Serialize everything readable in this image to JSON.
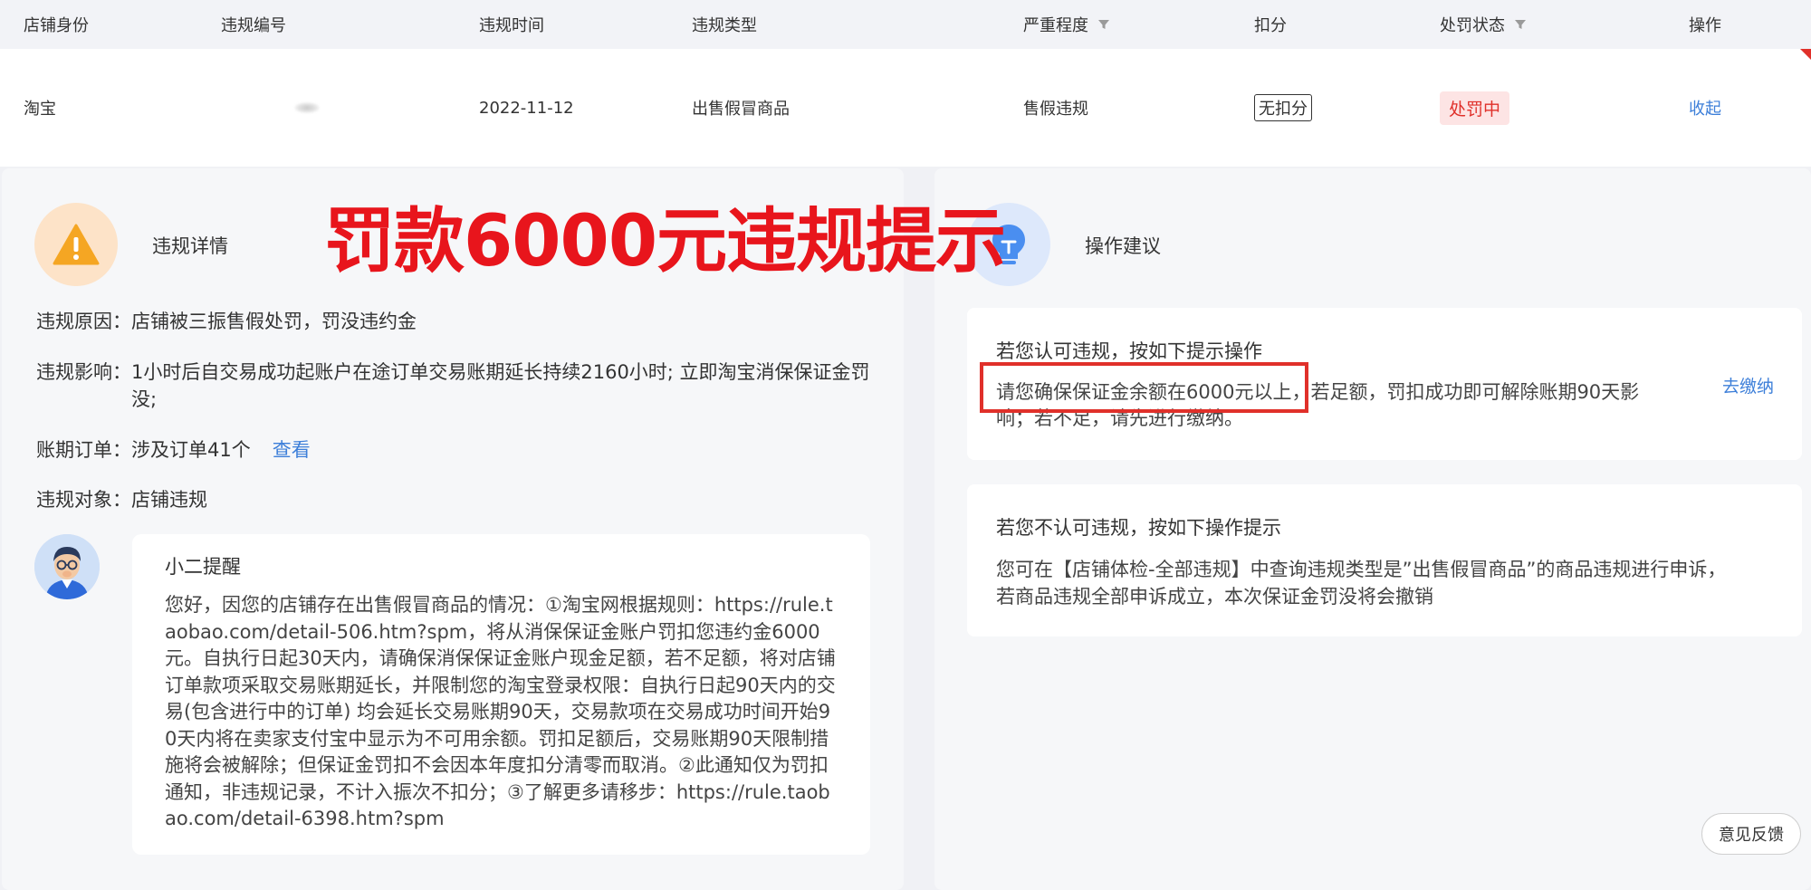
{
  "table": {
    "headers": {
      "store_identity": "店铺身份",
      "violation_no": "违规编号",
      "violation_time": "违规时间",
      "violation_type": "违规类型",
      "severity": "严重程度",
      "deduction": "扣分",
      "penalty_status": "处罚状态",
      "action": "操作"
    },
    "row": {
      "store_identity": "淘宝",
      "violation_no": "",
      "violation_time": "2022-11-12",
      "violation_type": "出售假冒商品",
      "severity": "售假违规",
      "deduction": "无扣分",
      "penalty_status": "处罚中",
      "action": "收起"
    }
  },
  "overlay": {
    "title": "罚款6000元违规提示"
  },
  "details": {
    "title": "违规详情",
    "reason_label": "违规原因：",
    "reason_value": "店铺被三振售假处罚，罚没违约金",
    "impact_label": "违规影响：",
    "impact_value": "1小时后自交易成功起账户在途订单交易账期延长持续2160小时; 立即淘宝消保保证金罚没;",
    "orders_label": "账期订单：",
    "orders_value": "涉及订单41个",
    "orders_link": "查看",
    "target_label": "违规对象：",
    "target_value": "店铺违规",
    "reminder_title": "小二提醒",
    "reminder_text": "您好，因您的店铺存在出售假冒商品的情况：①淘宝网根据规则：https://rule.taobao.com/detail-506.htm?spm，将从消保保证金账户罚扣您违约金6000元。自执行日起30天内，请确保消保保证金账户现金足额，若不足额，将对店铺订单款项采取交易账期延长，并限制您的淘宝登录权限：自执行日起90天内的交易(包含进行中的订单) 均会延长交易账期90天，交易款项在交易成功时间开始90天内将在卖家支付宝中显示为不可用余额。罚扣足额后，交易账期90天限制措施将会被解除；但保证金罚扣不会因本年度扣分清零而取消。②此通知仅为罚扣通知，非违规记录，不计入振次不扣分；③了解更多请移步：https://rule.taobao.com/detail-6398.htm?spm"
  },
  "advice": {
    "title": "操作建议",
    "card1_title": "若您认可违规，按如下提示操作",
    "card1_line1": "请您确保保证金余额在6000元以上，若足额，罚扣成功即可解除账期90天影",
    "card1_line2": "响；若不足，请先进行缴纳。",
    "card1_link": "去缴纳",
    "card2_title": "若您不认可违规，按如下操作提示",
    "card2_text": "您可在【店铺体检-全部违规】中查询违规类型是”出售假冒商品”的商品违规进行申诉，若商品违规全部申诉成立，本次保证金罚没将会撤销"
  },
  "feedback": {
    "label": "意见反馈"
  },
  "colors": {
    "warning_orange": "#f5a623",
    "advice_blue": "#4a8ef0",
    "alert_red": "#e0302a",
    "link_blue": "#3d7fd9"
  },
  "icons": {
    "severity_filter": "filter-icon",
    "status_filter": "filter-icon",
    "details": "warning-icon",
    "advice": "lightbulb-icon",
    "reminder": "avatar"
  }
}
